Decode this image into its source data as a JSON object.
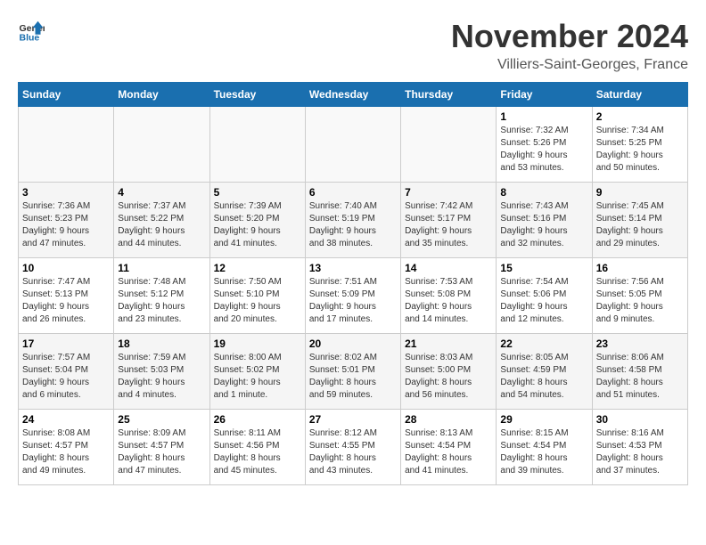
{
  "header": {
    "logo_general": "General",
    "logo_blue": "Blue",
    "month_title": "November 2024",
    "location": "Villiers-Saint-Georges, France"
  },
  "weekdays": [
    "Sunday",
    "Monday",
    "Tuesday",
    "Wednesday",
    "Thursday",
    "Friday",
    "Saturday"
  ],
  "weeks": [
    [
      {
        "day": "",
        "info": ""
      },
      {
        "day": "",
        "info": ""
      },
      {
        "day": "",
        "info": ""
      },
      {
        "day": "",
        "info": ""
      },
      {
        "day": "",
        "info": ""
      },
      {
        "day": "1",
        "info": "Sunrise: 7:32 AM\nSunset: 5:26 PM\nDaylight: 9 hours\nand 53 minutes."
      },
      {
        "day": "2",
        "info": "Sunrise: 7:34 AM\nSunset: 5:25 PM\nDaylight: 9 hours\nand 50 minutes."
      }
    ],
    [
      {
        "day": "3",
        "info": "Sunrise: 7:36 AM\nSunset: 5:23 PM\nDaylight: 9 hours\nand 47 minutes."
      },
      {
        "day": "4",
        "info": "Sunrise: 7:37 AM\nSunset: 5:22 PM\nDaylight: 9 hours\nand 44 minutes."
      },
      {
        "day": "5",
        "info": "Sunrise: 7:39 AM\nSunset: 5:20 PM\nDaylight: 9 hours\nand 41 minutes."
      },
      {
        "day": "6",
        "info": "Sunrise: 7:40 AM\nSunset: 5:19 PM\nDaylight: 9 hours\nand 38 minutes."
      },
      {
        "day": "7",
        "info": "Sunrise: 7:42 AM\nSunset: 5:17 PM\nDaylight: 9 hours\nand 35 minutes."
      },
      {
        "day": "8",
        "info": "Sunrise: 7:43 AM\nSunset: 5:16 PM\nDaylight: 9 hours\nand 32 minutes."
      },
      {
        "day": "9",
        "info": "Sunrise: 7:45 AM\nSunset: 5:14 PM\nDaylight: 9 hours\nand 29 minutes."
      }
    ],
    [
      {
        "day": "10",
        "info": "Sunrise: 7:47 AM\nSunset: 5:13 PM\nDaylight: 9 hours\nand 26 minutes."
      },
      {
        "day": "11",
        "info": "Sunrise: 7:48 AM\nSunset: 5:12 PM\nDaylight: 9 hours\nand 23 minutes."
      },
      {
        "day": "12",
        "info": "Sunrise: 7:50 AM\nSunset: 5:10 PM\nDaylight: 9 hours\nand 20 minutes."
      },
      {
        "day": "13",
        "info": "Sunrise: 7:51 AM\nSunset: 5:09 PM\nDaylight: 9 hours\nand 17 minutes."
      },
      {
        "day": "14",
        "info": "Sunrise: 7:53 AM\nSunset: 5:08 PM\nDaylight: 9 hours\nand 14 minutes."
      },
      {
        "day": "15",
        "info": "Sunrise: 7:54 AM\nSunset: 5:06 PM\nDaylight: 9 hours\nand 12 minutes."
      },
      {
        "day": "16",
        "info": "Sunrise: 7:56 AM\nSunset: 5:05 PM\nDaylight: 9 hours\nand 9 minutes."
      }
    ],
    [
      {
        "day": "17",
        "info": "Sunrise: 7:57 AM\nSunset: 5:04 PM\nDaylight: 9 hours\nand 6 minutes."
      },
      {
        "day": "18",
        "info": "Sunrise: 7:59 AM\nSunset: 5:03 PM\nDaylight: 9 hours\nand 4 minutes."
      },
      {
        "day": "19",
        "info": "Sunrise: 8:00 AM\nSunset: 5:02 PM\nDaylight: 9 hours\nand 1 minute."
      },
      {
        "day": "20",
        "info": "Sunrise: 8:02 AM\nSunset: 5:01 PM\nDaylight: 8 hours\nand 59 minutes."
      },
      {
        "day": "21",
        "info": "Sunrise: 8:03 AM\nSunset: 5:00 PM\nDaylight: 8 hours\nand 56 minutes."
      },
      {
        "day": "22",
        "info": "Sunrise: 8:05 AM\nSunset: 4:59 PM\nDaylight: 8 hours\nand 54 minutes."
      },
      {
        "day": "23",
        "info": "Sunrise: 8:06 AM\nSunset: 4:58 PM\nDaylight: 8 hours\nand 51 minutes."
      }
    ],
    [
      {
        "day": "24",
        "info": "Sunrise: 8:08 AM\nSunset: 4:57 PM\nDaylight: 8 hours\nand 49 minutes."
      },
      {
        "day": "25",
        "info": "Sunrise: 8:09 AM\nSunset: 4:57 PM\nDaylight: 8 hours\nand 47 minutes."
      },
      {
        "day": "26",
        "info": "Sunrise: 8:11 AM\nSunset: 4:56 PM\nDaylight: 8 hours\nand 45 minutes."
      },
      {
        "day": "27",
        "info": "Sunrise: 8:12 AM\nSunset: 4:55 PM\nDaylight: 8 hours\nand 43 minutes."
      },
      {
        "day": "28",
        "info": "Sunrise: 8:13 AM\nSunset: 4:54 PM\nDaylight: 8 hours\nand 41 minutes."
      },
      {
        "day": "29",
        "info": "Sunrise: 8:15 AM\nSunset: 4:54 PM\nDaylight: 8 hours\nand 39 minutes."
      },
      {
        "day": "30",
        "info": "Sunrise: 8:16 AM\nSunset: 4:53 PM\nDaylight: 8 hours\nand 37 minutes."
      }
    ]
  ]
}
